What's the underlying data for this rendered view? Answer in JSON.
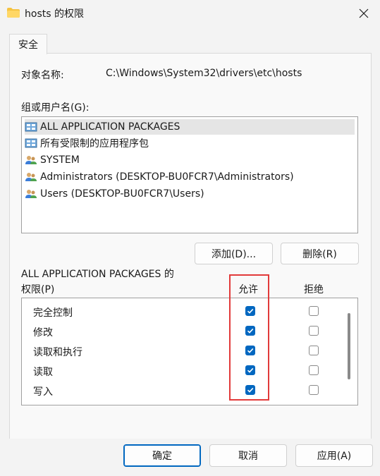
{
  "window": {
    "title": "hosts 的权限"
  },
  "tabs": [
    {
      "label": "安全"
    }
  ],
  "object_label": "对象名称:",
  "object_path": "C:\\Windows\\System32\\drivers\\etc\\hosts",
  "group_label": "组或用户名(G):",
  "groups": [
    {
      "label": "ALL APPLICATION PACKAGES",
      "icon": "package-group-icon",
      "selected": true
    },
    {
      "label": "所有受限制的应用程序包",
      "icon": "package-group-icon",
      "selected": false
    },
    {
      "label": "SYSTEM",
      "icon": "users-icon",
      "selected": false
    },
    {
      "label": "Administrators (DESKTOP-BU0FCR7\\Administrators)",
      "icon": "users-icon",
      "selected": false
    },
    {
      "label": "Users (DESKTOP-BU0FCR7\\Users)",
      "icon": "users-icon",
      "selected": false
    }
  ],
  "buttons": {
    "add": "添加(D)...",
    "remove": "删除(R)",
    "ok": "确定",
    "cancel": "取消",
    "apply": "应用(A)"
  },
  "perm_header_line1": "ALL APPLICATION PACKAGES 的",
  "perm_header_line2": "权限(P)",
  "col_allow": "允许",
  "col_deny": "拒绝",
  "permissions": [
    {
      "name": "完全控制",
      "allow": true,
      "deny": false
    },
    {
      "name": "修改",
      "allow": true,
      "deny": false
    },
    {
      "name": "读取和执行",
      "allow": true,
      "deny": false
    },
    {
      "name": "读取",
      "allow": true,
      "deny": false
    },
    {
      "name": "写入",
      "allow": true,
      "deny": false
    }
  ],
  "colors": {
    "accent": "#0067c0",
    "highlight": "#e23a3a"
  }
}
